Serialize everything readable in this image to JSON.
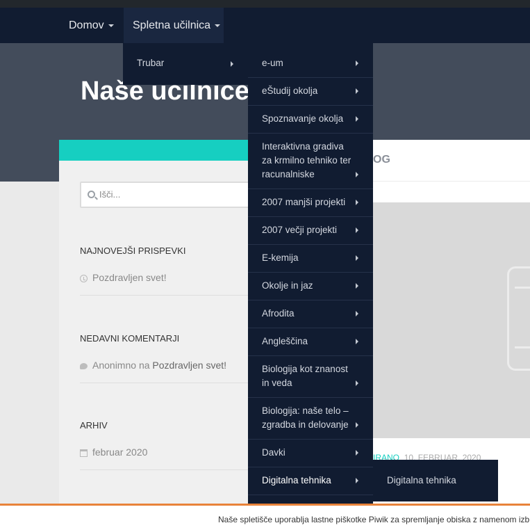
{
  "nav": {
    "items": [
      {
        "label": "Domov"
      },
      {
        "label": "Spletna učilnica"
      }
    ]
  },
  "hero": {
    "title": "Naše učilnice"
  },
  "search": {
    "placeholder": "Išči..."
  },
  "widgets": {
    "latest": {
      "title": "NAJNOVEJŠI PRISPEVKI",
      "item": "Pozdravljen svet!"
    },
    "comments": {
      "title": "NEDAVNI KOMENTARJI",
      "author": "Anonimno",
      "conj": "na",
      "post": "Pozdravljen svet!"
    },
    "archive": {
      "title": "ARHIV",
      "item": "februar 2020"
    }
  },
  "content": {
    "heading": "OG",
    "meta_category": "IRANO",
    "meta_date": "10. FEBRUAR, 2020"
  },
  "menu": {
    "level1": [
      "Trubar"
    ],
    "level2": [
      "e-um",
      "eŠtudij okolja",
      "Spoznavanje okolja",
      "Interaktivna gradiva za krmilno tehniko ter racunalniske",
      "2007 manjši projekti",
      "2007 večji projekti",
      "E-kemija",
      "Okolje in jaz",
      "Afrodita",
      "Angleščina",
      "Biologija kot znanost in veda",
      "Biologija: naše telo – zgradba in delovanje",
      "Davki",
      "Digitalna tehnika"
    ],
    "level3": [
      "Digitalna tehnika"
    ]
  },
  "cookie": {
    "text": "Naše spletišče uporablja lastne piškotke Piwik za spremljanje obiska z namenom izb"
  },
  "colors": {
    "navbar": "#111c31",
    "accent": "#16cfc1",
    "cookie_border": "#e8833a",
    "hero": "#434c5b"
  }
}
